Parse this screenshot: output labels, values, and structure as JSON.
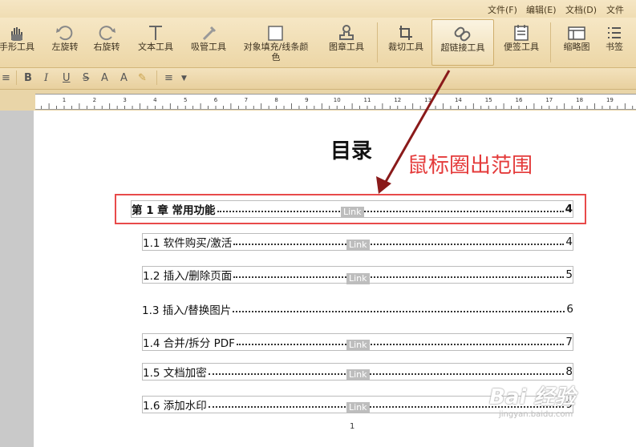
{
  "menu": {
    "file": "文件(F)",
    "edit": "编辑(E)",
    "doc": "文档(D)",
    "file2": "文件"
  },
  "toolbar": {
    "tools": [
      {
        "label": "手形工具",
        "icon": "hand-icon"
      },
      {
        "label": "左旋转",
        "icon": "rotate-left-icon"
      },
      {
        "label": "右旋转",
        "icon": "rotate-right-icon"
      },
      {
        "label": "文本工具",
        "icon": "text-tool-icon"
      },
      {
        "label": "吸管工具",
        "icon": "eyedropper-icon"
      },
      {
        "label": "对象填充/线条颜",
        "label2": "色",
        "icon": "fill-color-icon"
      },
      {
        "label": "图章工具",
        "icon": "stamp-icon"
      },
      {
        "label": "裁切工具",
        "icon": "crop-icon"
      },
      {
        "label": "超链接工具",
        "icon": "link-icon"
      },
      {
        "label": "便签工具",
        "icon": "note-icon"
      },
      {
        "label": "缩略图",
        "icon": "thumbnail-icon"
      },
      {
        "label": "书签",
        "icon": "bookmark-icon"
      }
    ]
  },
  "format": {
    "bold": "B",
    "italic": "I",
    "underline": "U",
    "strike": "S",
    "super": "A",
    "sub": "A"
  },
  "ruler": {
    "ticks": [
      "1",
      "2",
      "3",
      "4",
      "5",
      "6",
      "7",
      "8",
      "9",
      "10",
      "11",
      "12",
      "13",
      "14",
      "15",
      "16",
      "17",
      "18",
      "19"
    ]
  },
  "document": {
    "heading": "目录",
    "annotation": "鼠标圈出范围",
    "link_tag": "Link",
    "entries": [
      {
        "title": "第 1 章  常用功能",
        "page": "4"
      },
      {
        "title": "1.1 软件购买/激活",
        "page": "4"
      },
      {
        "title": "1.2 插入/删除页面",
        "page": "5"
      },
      {
        "title": "1.3 插入/替换图片",
        "page": "6"
      },
      {
        "title": "1.4 合并/拆分 PDF",
        "page": "7"
      },
      {
        "title": "1.5 文档加密",
        "page": "8"
      },
      {
        "title": "1.6 添加水印",
        "page": "9"
      }
    ],
    "page_number": "1"
  },
  "watermark": {
    "main": "Bai 经验",
    "sub": "jingyan.baidu.com"
  },
  "colors": {
    "annotation_red": "#e43a3a",
    "toolbar_bg": "#f0ddb3"
  }
}
